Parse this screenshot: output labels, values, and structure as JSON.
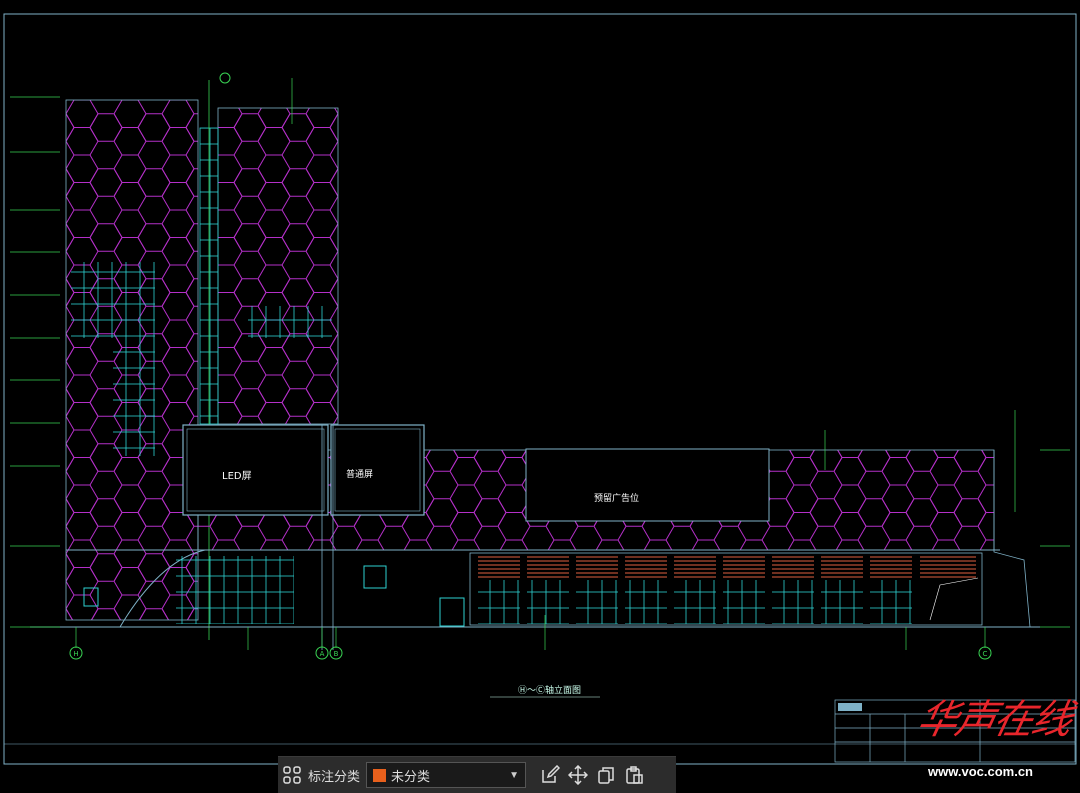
{
  "drawing": {
    "screen_label_led": "LED屏",
    "screen_label_common": "普通屏",
    "ad_label": "预留广告位",
    "title": "Ⓗ～Ⓒ轴立面图",
    "grid_left": "H",
    "grid_mid_a": "A",
    "grid_mid_b": "B",
    "grid_right": "C"
  },
  "watermark": {
    "chars": "华声在线",
    "url": "www.voc.com.cn"
  },
  "toolbar": {
    "label": "标注分类",
    "select_value": "未分类",
    "swatch_color": "#e8601c",
    "icons": [
      "grid-icon",
      "edit-icon",
      "move-icon",
      "copy-icon",
      "paste-icon"
    ]
  },
  "colors": {
    "hex_pattern": "#b42fc8",
    "glazing": "#2ed2d2",
    "annotation": "#39d353",
    "frame": "#7fb2c8"
  }
}
